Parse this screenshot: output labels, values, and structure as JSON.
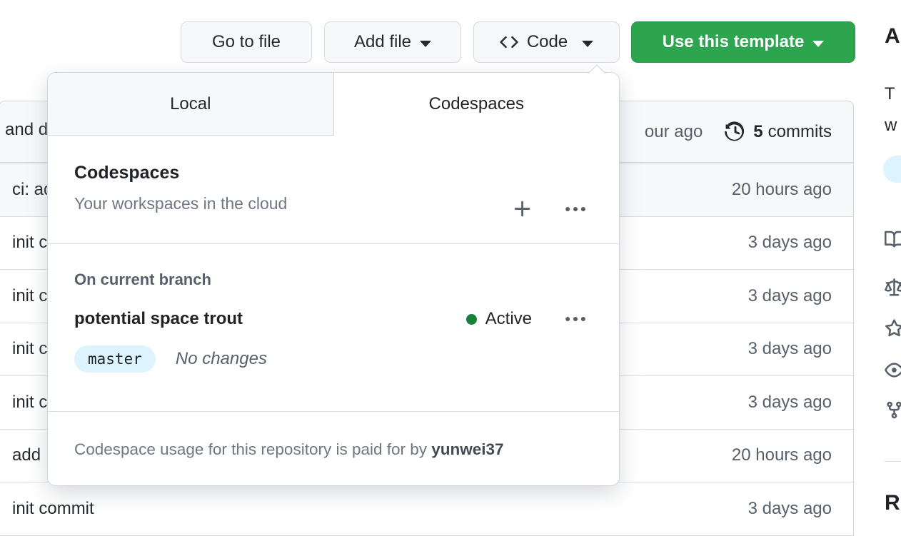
{
  "toolbar": {
    "go_to_file_label": "Go to file",
    "add_file_label": "Add file",
    "code_label": "Code",
    "use_template_label": "Use this template"
  },
  "commit_bar": {
    "message_partial": "and d",
    "time_partial": "our ago",
    "commit_count": "5",
    "commits_label": "commits"
  },
  "file_table": {
    "rows": [
      {
        "message": "ci: ad",
        "time": "20 hours ago"
      },
      {
        "message": "init c",
        "time": "3 days ago"
      },
      {
        "message": "init c",
        "time": "3 days ago"
      },
      {
        "message": "init c",
        "time": "3 days ago"
      },
      {
        "message": "init c",
        "time": "3 days ago"
      },
      {
        "message": "add",
        "time": "20 hours ago"
      },
      {
        "message": "init commit",
        "time": "3 days ago"
      }
    ]
  },
  "dropdown": {
    "tabs": {
      "local": "Local",
      "codespaces": "Codespaces"
    },
    "codespaces_panel": {
      "title": "Codespaces",
      "subtitle": "Your workspaces in the cloud"
    },
    "branch_section": {
      "heading": "On current branch",
      "codespace_name": "potential space trout",
      "status_label": "Active",
      "branch_name": "master",
      "changes_label": "No changes"
    },
    "footer": {
      "text_prefix": "Codespace usage for this repository is paid for by",
      "owner": "yunwei37"
    }
  },
  "sidebar": {
    "about_heading_partial": "A",
    "description_line1_partial": "T",
    "description_line2_partial": "w",
    "releases_heading_partial": "R"
  },
  "icons": {
    "code-icon": "<>",
    "caret-down-icon": "▾",
    "history-icon": "🕘",
    "plus-icon": "+",
    "kebab-icon": "⋯",
    "active-dot": "●",
    "book-icon": "📖",
    "law-icon": "⚖",
    "star-icon": "☆",
    "eye-icon": "👁",
    "fork-icon": "⑂"
  },
  "colors": {
    "accent_green": "#2da44e",
    "active_dot_green": "#1a7f37",
    "branch_pill_bg": "#ddf4ff",
    "muted_text": "#57606a",
    "border": "#d0d7de",
    "highlight_row_bg": "#f6f8fa"
  }
}
